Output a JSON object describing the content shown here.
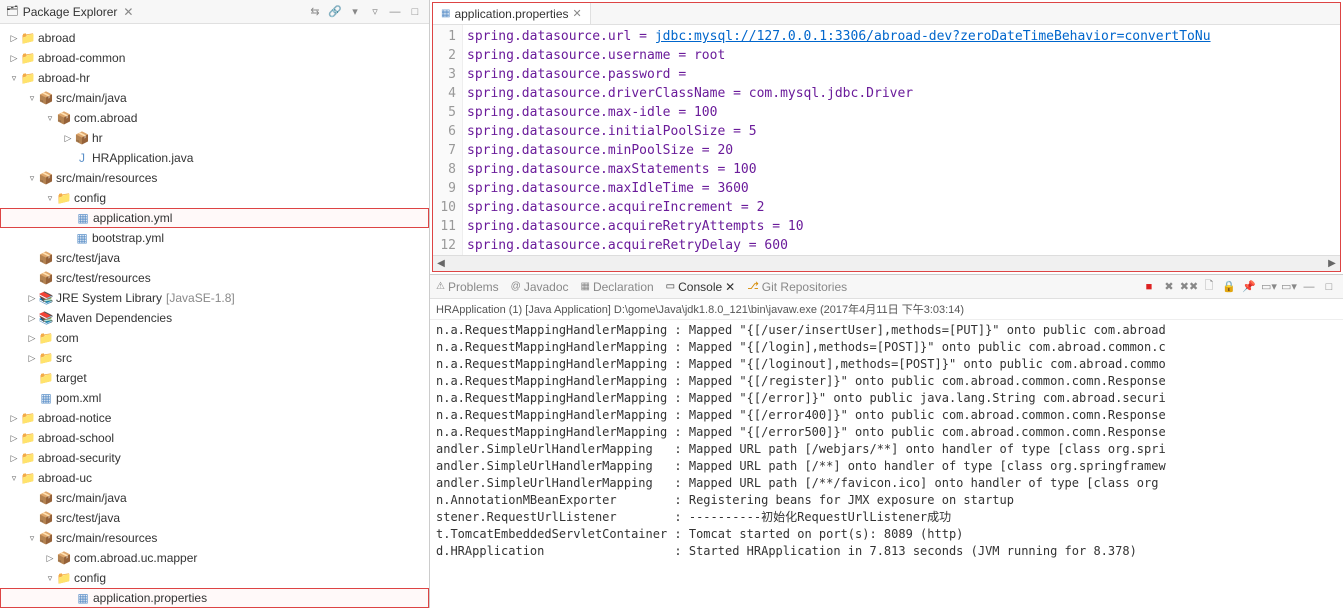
{
  "package_explorer": {
    "title": "Package Explorer",
    "tree": [
      {
        "indent": 0,
        "arrow": "▷",
        "icon": "folder",
        "label": "abroad"
      },
      {
        "indent": 0,
        "arrow": "▷",
        "icon": "folder",
        "label": "abroad-common"
      },
      {
        "indent": 0,
        "arrow": "▿",
        "icon": "folder",
        "label": "abroad-hr"
      },
      {
        "indent": 1,
        "arrow": "▿",
        "icon": "pkg",
        "label": "src/main/java"
      },
      {
        "indent": 2,
        "arrow": "▿",
        "icon": "pkg",
        "label": "com.abroad"
      },
      {
        "indent": 3,
        "arrow": "▷",
        "icon": "pkg",
        "label": "hr"
      },
      {
        "indent": 3,
        "arrow": "",
        "icon": "j",
        "label": "HRApplication.java"
      },
      {
        "indent": 1,
        "arrow": "▿",
        "icon": "pkg",
        "label": "src/main/resources"
      },
      {
        "indent": 2,
        "arrow": "▿",
        "icon": "folder",
        "label": "config"
      },
      {
        "indent": 3,
        "arrow": "",
        "icon": "file",
        "label": "application.yml",
        "highlight": true
      },
      {
        "indent": 3,
        "arrow": "",
        "icon": "file",
        "label": "bootstrap.yml"
      },
      {
        "indent": 1,
        "arrow": "",
        "icon": "pkg",
        "label": "src/test/java"
      },
      {
        "indent": 1,
        "arrow": "",
        "icon": "pkg",
        "label": "src/test/resources"
      },
      {
        "indent": 1,
        "arrow": "▷",
        "icon": "lib",
        "label": "JRE System Library",
        "suffix": "[JavaSE-1.8]"
      },
      {
        "indent": 1,
        "arrow": "▷",
        "icon": "lib",
        "label": "Maven Dependencies"
      },
      {
        "indent": 1,
        "arrow": "▷",
        "icon": "folder",
        "label": "com"
      },
      {
        "indent": 1,
        "arrow": "▷",
        "icon": "folder",
        "label": "src"
      },
      {
        "indent": 1,
        "arrow": "",
        "icon": "folder",
        "label": "target"
      },
      {
        "indent": 1,
        "arrow": "",
        "icon": "file",
        "label": "pom.xml"
      },
      {
        "indent": 0,
        "arrow": "▷",
        "icon": "folder",
        "label": "abroad-notice"
      },
      {
        "indent": 0,
        "arrow": "▷",
        "icon": "folder",
        "label": "abroad-school"
      },
      {
        "indent": 0,
        "arrow": "▷",
        "icon": "folder",
        "label": "abroad-security"
      },
      {
        "indent": 0,
        "arrow": "▿",
        "icon": "folder",
        "label": "abroad-uc"
      },
      {
        "indent": 1,
        "arrow": "",
        "icon": "pkg",
        "label": "src/main/java"
      },
      {
        "indent": 1,
        "arrow": "",
        "icon": "pkg",
        "label": "src/test/java"
      },
      {
        "indent": 1,
        "arrow": "▿",
        "icon": "pkg",
        "label": "src/main/resources"
      },
      {
        "indent": 2,
        "arrow": "▷",
        "icon": "pkg",
        "label": "com.abroad.uc.mapper"
      },
      {
        "indent": 2,
        "arrow": "▿",
        "icon": "folder",
        "label": "config"
      },
      {
        "indent": 3,
        "arrow": "",
        "icon": "file",
        "label": "application.properties",
        "highlight": true
      }
    ]
  },
  "editor": {
    "tab_title": "application.properties",
    "lines": [
      {
        "n": 1,
        "text": "spring.datasource.url = ",
        "link": "jdbc:mysql://127.0.0.1:3306/abroad-dev?zeroDateTimeBehavior=convertToNu"
      },
      {
        "n": 2,
        "text": "spring.datasource.username = root"
      },
      {
        "n": 3,
        "text": "spring.datasource.password ="
      },
      {
        "n": 4,
        "text": "spring.datasource.driverClassName = com.mysql.jdbc.Driver"
      },
      {
        "n": 5,
        "text": "spring.datasource.max-idle = 100"
      },
      {
        "n": 6,
        "text": "spring.datasource.initialPoolSize = 5"
      },
      {
        "n": 7,
        "text": "spring.datasource.minPoolSize = 20"
      },
      {
        "n": 8,
        "text": "spring.datasource.maxStatements = 100"
      },
      {
        "n": 9,
        "text": "spring.datasource.maxIdleTime = 3600"
      },
      {
        "n": 10,
        "text": "spring.datasource.acquireIncrement = 2"
      },
      {
        "n": 11,
        "text": "spring.datasource.acquireRetryAttempts = 10"
      },
      {
        "n": 12,
        "text": "spring.datasource.acquireRetryDelay = 600"
      }
    ]
  },
  "bottom_tabs": {
    "problems": "Problems",
    "javadoc": "Javadoc",
    "declaration": "Declaration",
    "console": "Console",
    "git": "Git Repositories"
  },
  "console": {
    "header": "HRApplication (1) [Java Application] D:\\gome\\Java\\jdk1.8.0_121\\bin\\javaw.exe (2017年4月11日 下午3:03:14)",
    "lines": [
      "n.a.RequestMappingHandlerMapping : Mapped \"{[/user/insertUser],methods=[PUT]}\" onto public com.abroad",
      "n.a.RequestMappingHandlerMapping : Mapped \"{[/login],methods=[POST]}\" onto public com.abroad.common.c",
      "n.a.RequestMappingHandlerMapping : Mapped \"{[/loginout],methods=[POST]}\" onto public com.abroad.commo",
      "n.a.RequestMappingHandlerMapping : Mapped \"{[/register]}\" onto public com.abroad.common.comn.Response",
      "n.a.RequestMappingHandlerMapping : Mapped \"{[/error]}\" onto public java.lang.String com.abroad.securi",
      "n.a.RequestMappingHandlerMapping : Mapped \"{[/error400]}\" onto public com.abroad.common.comn.Response",
      "n.a.RequestMappingHandlerMapping : Mapped \"{[/error500]}\" onto public com.abroad.common.comn.Response",
      "andler.SimpleUrlHandlerMapping   : Mapped URL path [/webjars/**] onto handler of type [class org.spri",
      "andler.SimpleUrlHandlerMapping   : Mapped URL path [/**] onto handler of type [class org.springframew",
      "andler.SimpleUrlHandlerMapping   : Mapped URL path [/**/favicon.ico] onto handler of type [class org",
      "n.AnnotationMBeanExporter        : Registering beans for JMX exposure on startup",
      "stener.RequestUrlListener        : ----------初始化RequestUrlListener成功",
      "t.TomcatEmbeddedServletContainer : Tomcat started on port(s): 8089 (http)",
      "d.HRApplication                  : Started HRApplication in 7.813 seconds (JVM running for 8.378)"
    ]
  }
}
